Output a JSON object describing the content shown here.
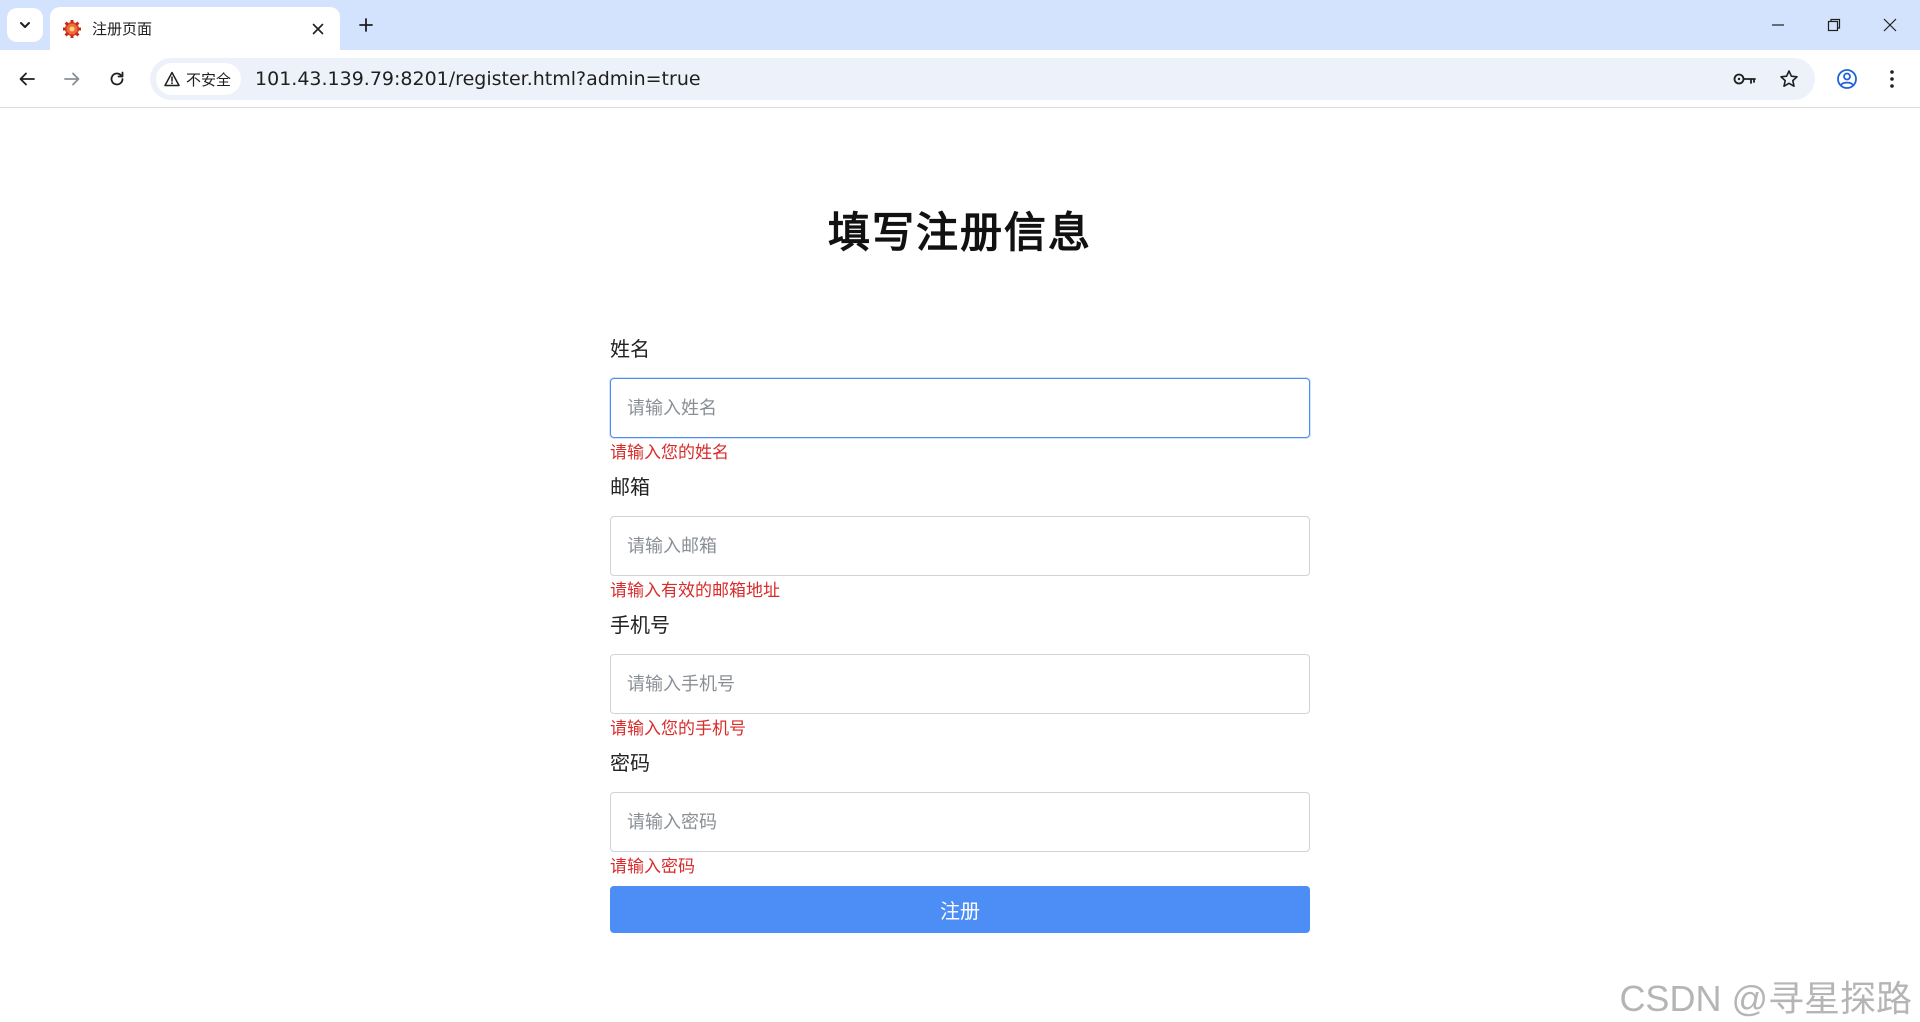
{
  "browser": {
    "tab_title": "注册页面",
    "security_label": "不安全",
    "url": "101.43.139.79:8201/register.html?admin=true"
  },
  "page": {
    "heading": "填写注册信息",
    "fields": [
      {
        "label": "姓名",
        "placeholder": "请输入姓名",
        "error": "请输入您的姓名"
      },
      {
        "label": "邮箱",
        "placeholder": "请输入邮箱",
        "error": "请输入有效的邮箱地址"
      },
      {
        "label": "手机号",
        "placeholder": "请输入手机号",
        "error": "请输入您的手机号"
      },
      {
        "label": "密码",
        "placeholder": "请输入密码",
        "error": "请输入密码"
      }
    ],
    "submit_label": "注册"
  },
  "watermark": "CSDN @寻星探路",
  "colors": {
    "tabstrip": "#d3e3fd",
    "accent": "#4c8df6",
    "error": "#d92b2b"
  }
}
